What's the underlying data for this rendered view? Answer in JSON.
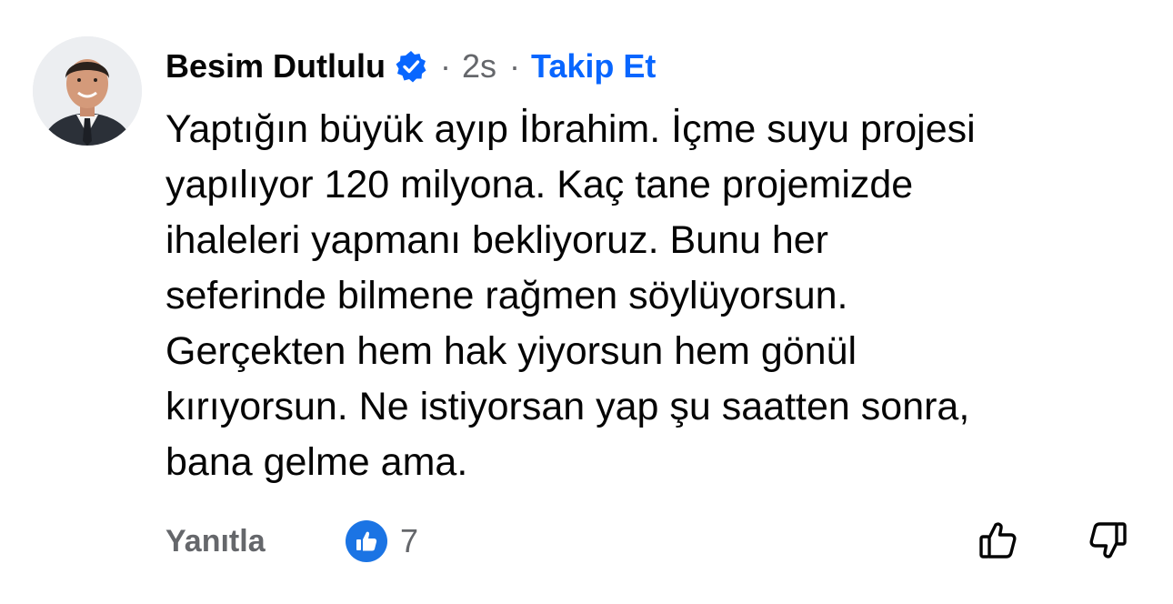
{
  "comment": {
    "author": "Besim Dutlulu",
    "verified_icon": "verified-badge-icon",
    "separator": "·",
    "time": "2s",
    "follow_label": "Takip Et",
    "body_lines": [
      "Yaptığın büyük ayıp İbrahim. İçme suyu projesi",
      "yapılıyor 120 milyona. Kaç tane projemizde",
      "ihaleleri yapmanı bekliyoruz. Bunu her",
      "seferinde bilmene rağmen söylüyorsun.",
      "Gerçekten hem hak yiyorsun hem gönül",
      "kırıyorsun. Ne istiyorsan yap şu saatten sonra,",
      "bana gelme ama."
    ],
    "reply_label": "Yanıtla",
    "reaction_icon": "like-reaction-icon",
    "reaction_count": "7",
    "upvote_icon": "thumbs-up-outline-icon",
    "downvote_icon": "thumbs-down-outline-icon"
  },
  "colors": {
    "text_primary": "#050505",
    "text_secondary": "#65676b",
    "accent_blue": "#0866ff",
    "like_blue": "#1b74e4"
  }
}
